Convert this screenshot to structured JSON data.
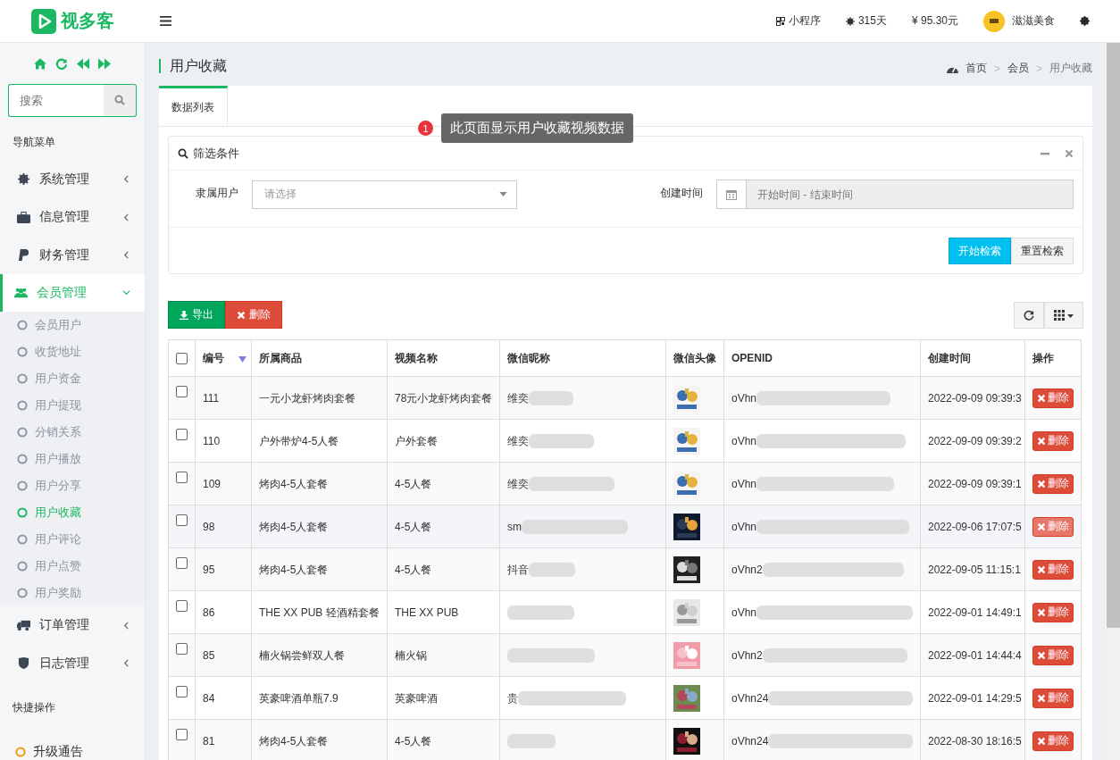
{
  "header": {
    "logo": "视多客",
    "items": [
      {
        "kind": "qr",
        "label": "小程序"
      },
      {
        "kind": "sun",
        "label": "315天"
      },
      {
        "kind": "plain",
        "label": "¥ 95.30元"
      }
    ],
    "user": "滋滋美食"
  },
  "sidebar": {
    "search": {
      "placeholder": "搜索"
    },
    "nav_heading": "导航菜单",
    "menu": [
      {
        "label": "系统管理",
        "expanded": false
      },
      {
        "label": "信息管理",
        "expanded": false
      },
      {
        "label": "财务管理",
        "expanded": false
      },
      {
        "label": "会员管理",
        "expanded": true,
        "children": [
          {
            "label": "会员用户",
            "selected": false
          },
          {
            "label": "收货地址",
            "selected": false
          },
          {
            "label": "用户资金",
            "selected": false
          },
          {
            "label": "用户提现",
            "selected": false
          },
          {
            "label": "分销关系",
            "selected": false
          },
          {
            "label": "用户播放",
            "selected": false
          },
          {
            "label": "用户分享",
            "selected": false
          },
          {
            "label": "用户收藏",
            "selected": true
          },
          {
            "label": "用户评论",
            "selected": false
          },
          {
            "label": "用户点赞",
            "selected": false
          },
          {
            "label": "用户奖励",
            "selected": false
          }
        ]
      },
      {
        "label": "订单管理",
        "expanded": false
      },
      {
        "label": "日志管理",
        "expanded": false
      }
    ],
    "quick_heading": "快捷操作",
    "quick_items": [
      "升级通告"
    ]
  },
  "page": {
    "title": "用户收藏",
    "breadcrumb": [
      "首页",
      "会员",
      "用户收藏"
    ],
    "separator": ">"
  },
  "tabs": [
    {
      "label": "数据列表",
      "selected": true
    }
  ],
  "annotation": {
    "number": "1",
    "text": "此页面显示用户收藏视频数据"
  },
  "filter": {
    "title": "筛选条件",
    "user_label": "隶属用户",
    "user_placeholder": "请选择",
    "time_label": "创建时间",
    "time_placeholder": "开始时间 - 结束时间",
    "buttons": [
      {
        "label": "开始检索",
        "kind": "primary"
      },
      {
        "label": "重置检索",
        "kind": "default"
      }
    ]
  },
  "toolbar": {
    "buttons": [
      {
        "label": "导出",
        "kind": "export"
      },
      {
        "label": "删除",
        "kind": "delete"
      }
    ]
  },
  "table": {
    "all_checked": false,
    "columns": [
      {
        "label": "编号",
        "sorted": true
      },
      {
        "label": "所属商品",
        "sorted": false
      },
      {
        "label": "视频名称",
        "sorted": false
      },
      {
        "label": "微信昵称",
        "sorted": false
      },
      {
        "label": "微信头像",
        "sorted": false
      },
      {
        "label": "OPENID",
        "sorted": false
      },
      {
        "label": "创建时间",
        "sorted": false
      },
      {
        "label": "操作",
        "sorted": false
      }
    ],
    "rows": [
      {
        "checked": false,
        "hovered": false,
        "id": "111",
        "product": "一元小龙虾烤肉套餐",
        "video": "78元小龙虾烤肉套餐",
        "nickname": "维奕",
        "openid": "oVhn",
        "created": "2022-09-09 09:39:3",
        "action": "删除"
      },
      {
        "checked": false,
        "hovered": false,
        "id": "110",
        "product": "户外带炉4-5人餐",
        "video": "户外套餐",
        "nickname": "维奕",
        "openid": "oVhn",
        "created": "2022-09-09 09:39:2",
        "action": "删除"
      },
      {
        "checked": false,
        "hovered": false,
        "id": "109",
        "product": "烤肉4-5人套餐",
        "video": "4-5人餐",
        "nickname": "维奕",
        "openid": "oVhn",
        "created": "2022-09-09 09:39:1",
        "action": "删除"
      },
      {
        "checked": false,
        "hovered": true,
        "id": "98",
        "product": "烤肉4-5人套餐",
        "video": "4-5人餐",
        "nickname": "sm",
        "openid": "oVhn",
        "created": "2022-09-06 17:07:5",
        "action": "删除"
      },
      {
        "checked": false,
        "hovered": false,
        "id": "95",
        "product": "烤肉4-5人套餐",
        "video": "4-5人餐",
        "nickname": "抖音",
        "openid": "oVhn2",
        "created": "2022-09-05 11:15:1",
        "action": "删除"
      },
      {
        "checked": false,
        "hovered": false,
        "id": "86",
        "product": "THE XX PUB 轻酒精套餐",
        "video": "THE XX PUB",
        "openid": "oVhn",
        "created": "2022-09-01 14:49:1",
        "action": "删除"
      },
      {
        "checked": false,
        "hovered": false,
        "id": "85",
        "product": "楠火锅尝鲜双人餐",
        "video": "楠火锅",
        "openid": "oVhn2",
        "created": "2022-09-01 14:44:4",
        "action": "删除"
      },
      {
        "checked": false,
        "hovered": false,
        "id": "84",
        "product": "英豪啤酒单瓶7.9",
        "video": "英豪啤酒",
        "nickname": "贵",
        "openid": "oVhn24",
        "created": "2022-09-01 14:29:5",
        "action": "删除"
      },
      {
        "checked": false,
        "hovered": false,
        "id": "81",
        "product": "烤肉4-5人套餐",
        "video": "4-5人餐",
        "openid": "oVhn24",
        "created": "2022-08-30 18:16:5",
        "action": "删除"
      }
    ]
  }
}
